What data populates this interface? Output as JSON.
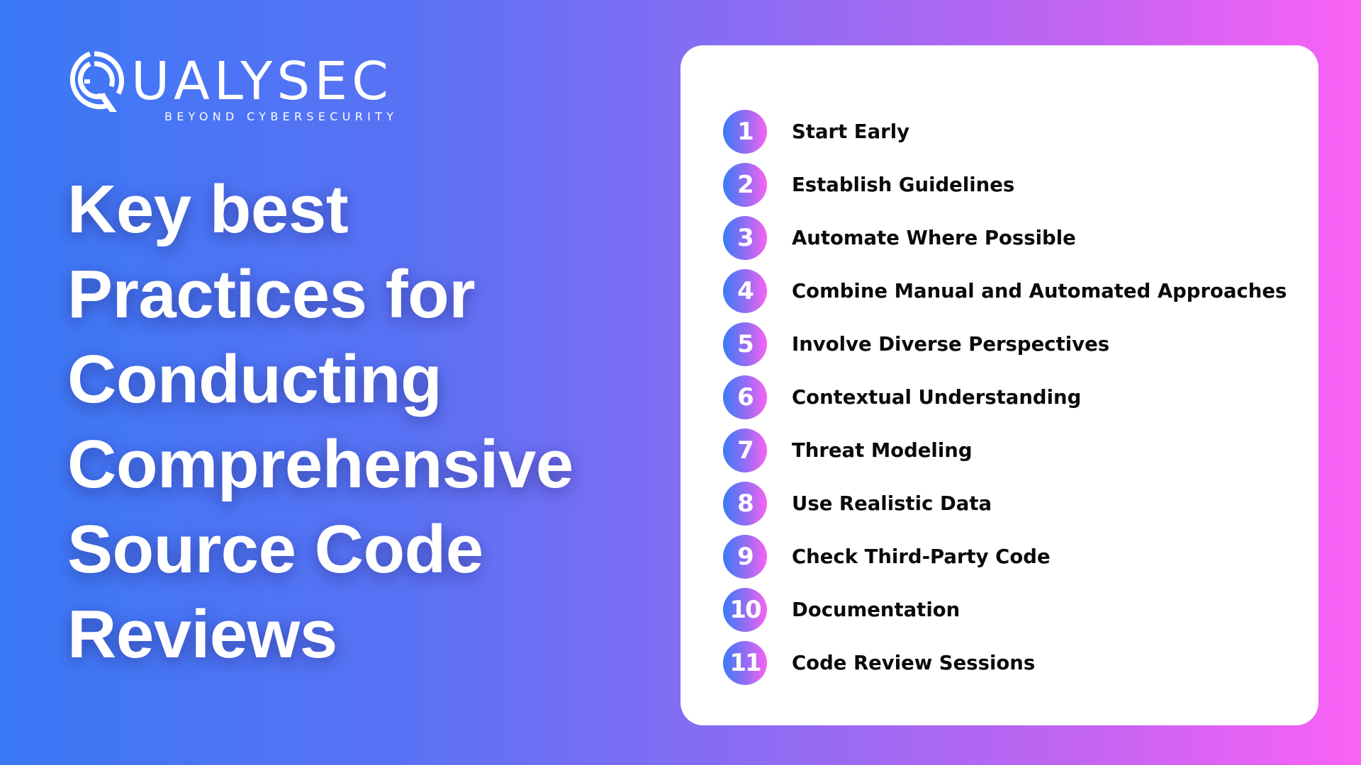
{
  "brand": {
    "name_after_q": "UALYSEC",
    "tagline": "BEYOND CYBERSECURITY",
    "logo_icon": "q-shield-logo-icon"
  },
  "headline": {
    "lines": [
      "Key best",
      "Practices for",
      "Conducting",
      "Comprehensive",
      "Source Code",
      "Reviews"
    ]
  },
  "practices": [
    {
      "number": "1",
      "label": "Start Early"
    },
    {
      "number": "2",
      "label": "Establish Guidelines"
    },
    {
      "number": "3",
      "label": "Automate Where Possible"
    },
    {
      "number": "4",
      "label": "Combine Manual and Automated Approaches"
    },
    {
      "number": "5",
      "label": "Involve Diverse Perspectives"
    },
    {
      "number": "6",
      "label": "Contextual Understanding"
    },
    {
      "number": "7",
      "label": "Threat Modeling"
    },
    {
      "number": "8",
      "label": "Use Realistic Data"
    },
    {
      "number": "9",
      "label": "Check Third-Party Code"
    },
    {
      "number": "10",
      "label": "Documentation"
    },
    {
      "number": "11",
      "label": "Code Review Sessions"
    }
  ],
  "colors": {
    "gradient_start": "#3a78f5",
    "gradient_mid": "#8b6cf3",
    "gradient_end": "#fb62f5",
    "card": "#ffffff",
    "list_text": "#0a0a0a"
  }
}
